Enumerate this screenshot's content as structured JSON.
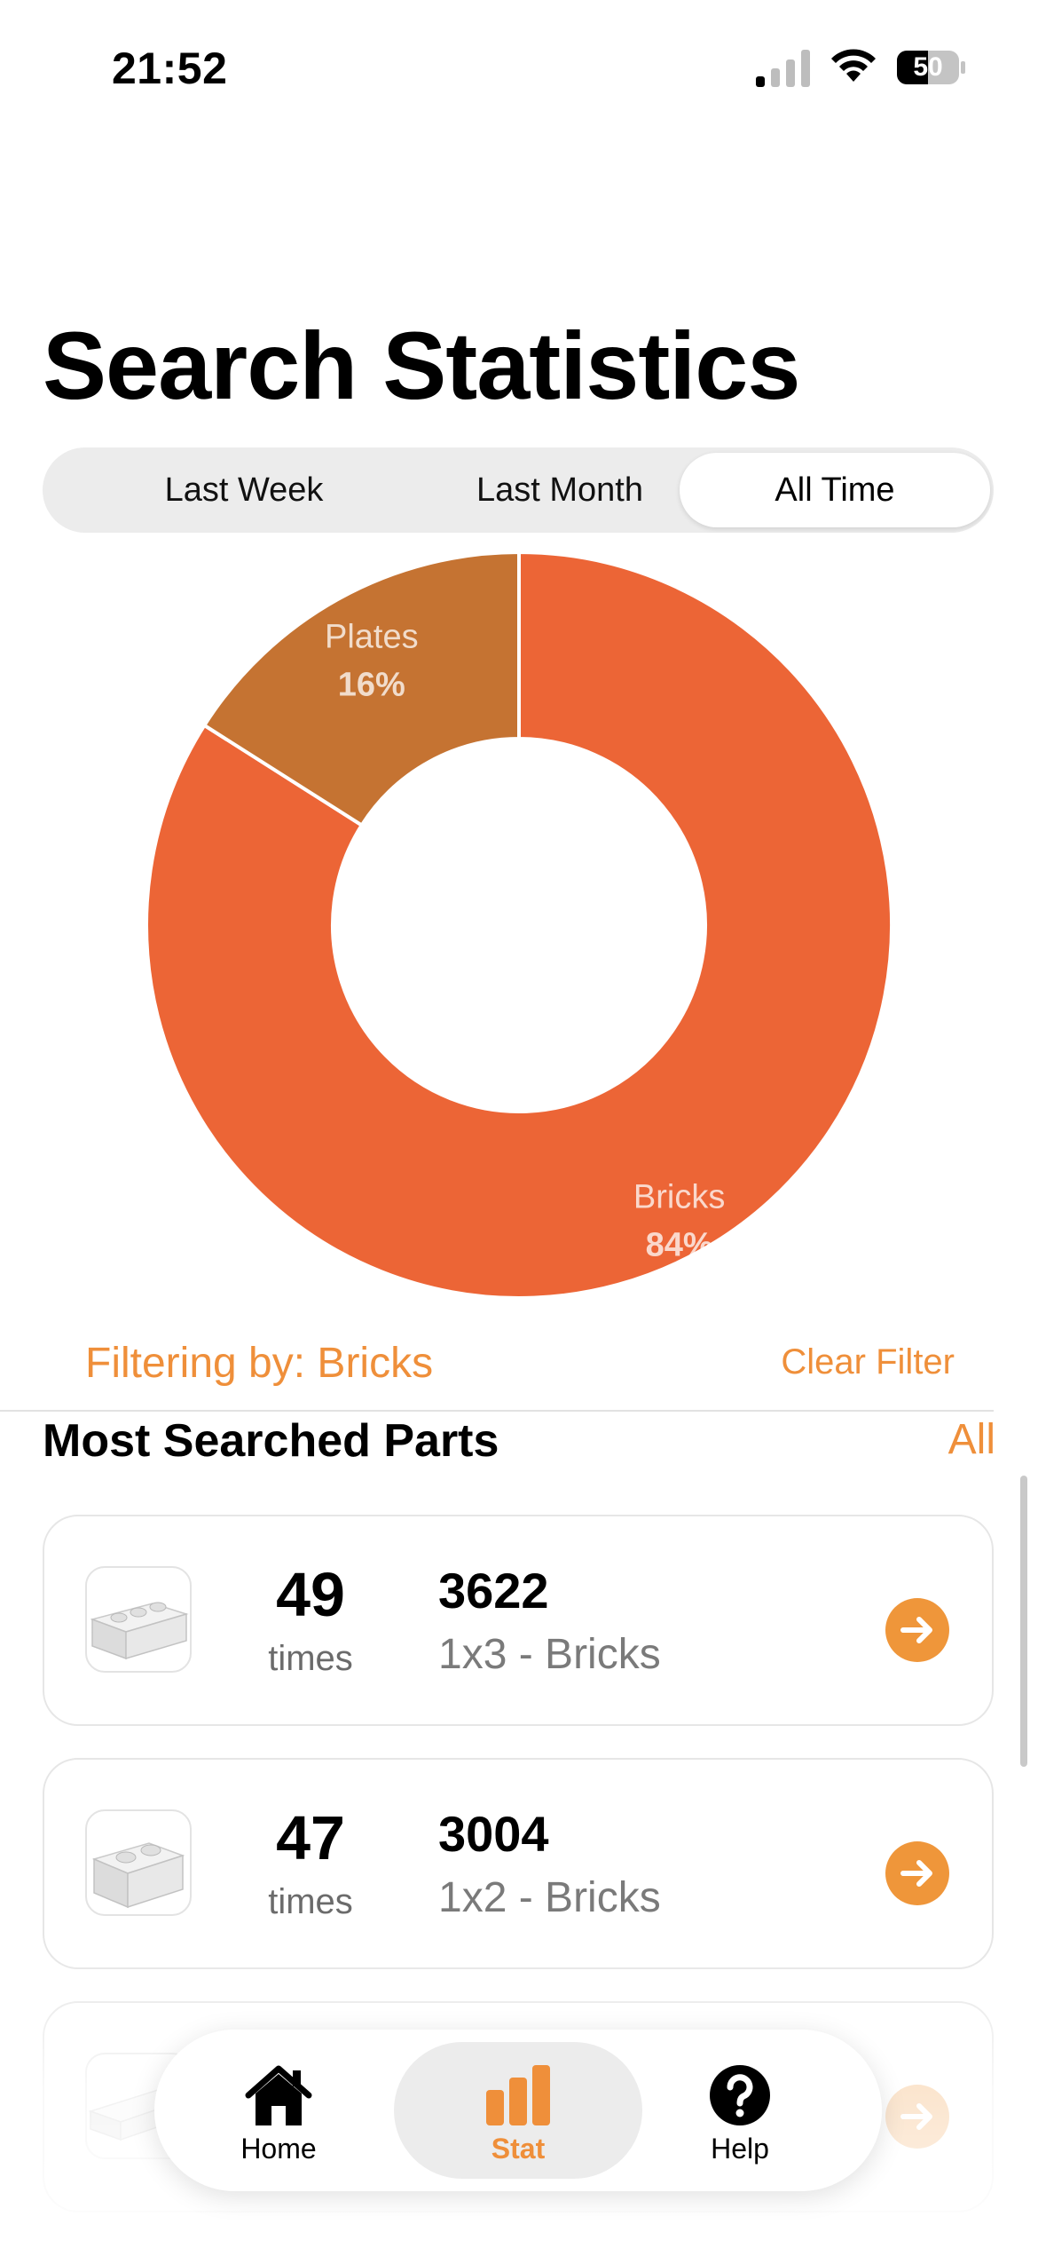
{
  "status_bar": {
    "time": "21:52",
    "battery": "50"
  },
  "page": {
    "title": "Search Statistics"
  },
  "period_tabs": [
    {
      "label": "Last Week",
      "selected": false
    },
    {
      "label": "Last Month",
      "selected": false
    },
    {
      "label": "All Time",
      "selected": true
    }
  ],
  "chart_data": {
    "type": "pie",
    "donut": true,
    "slices": [
      {
        "label": "Bricks",
        "value": 84,
        "display": "84%",
        "color": "#EC6536"
      },
      {
        "label": "Plates",
        "value": 16,
        "display": "16%",
        "color": "#C57332"
      }
    ]
  },
  "filter": {
    "text": "Filtering by: Bricks",
    "clear_label": "Clear Filter"
  },
  "parts_section": {
    "title": "Most Searched Parts",
    "all_label": "All",
    "items": [
      {
        "count": "49",
        "count_unit": "times",
        "part_number": "3622",
        "description": "1x3 - Bricks",
        "icon": "brick-1x3-icon"
      },
      {
        "count": "47",
        "count_unit": "times",
        "part_number": "3004",
        "description": "1x2 - Bricks",
        "icon": "brick-1x2-icon"
      },
      {
        "count": "",
        "count_unit": "",
        "part_number": "",
        "description": "",
        "icon": "brick-1x4-icon"
      }
    ]
  },
  "tab_bar": {
    "items": [
      {
        "label": "Home",
        "icon": "house-icon",
        "active": false
      },
      {
        "label": "Stat",
        "icon": "bar-chart-icon",
        "active": true
      },
      {
        "label": "Help",
        "icon": "question-icon",
        "active": false
      }
    ]
  },
  "colors": {
    "accent": "#EF8F3A",
    "bricks": "#EC6536",
    "plates": "#C57332"
  }
}
